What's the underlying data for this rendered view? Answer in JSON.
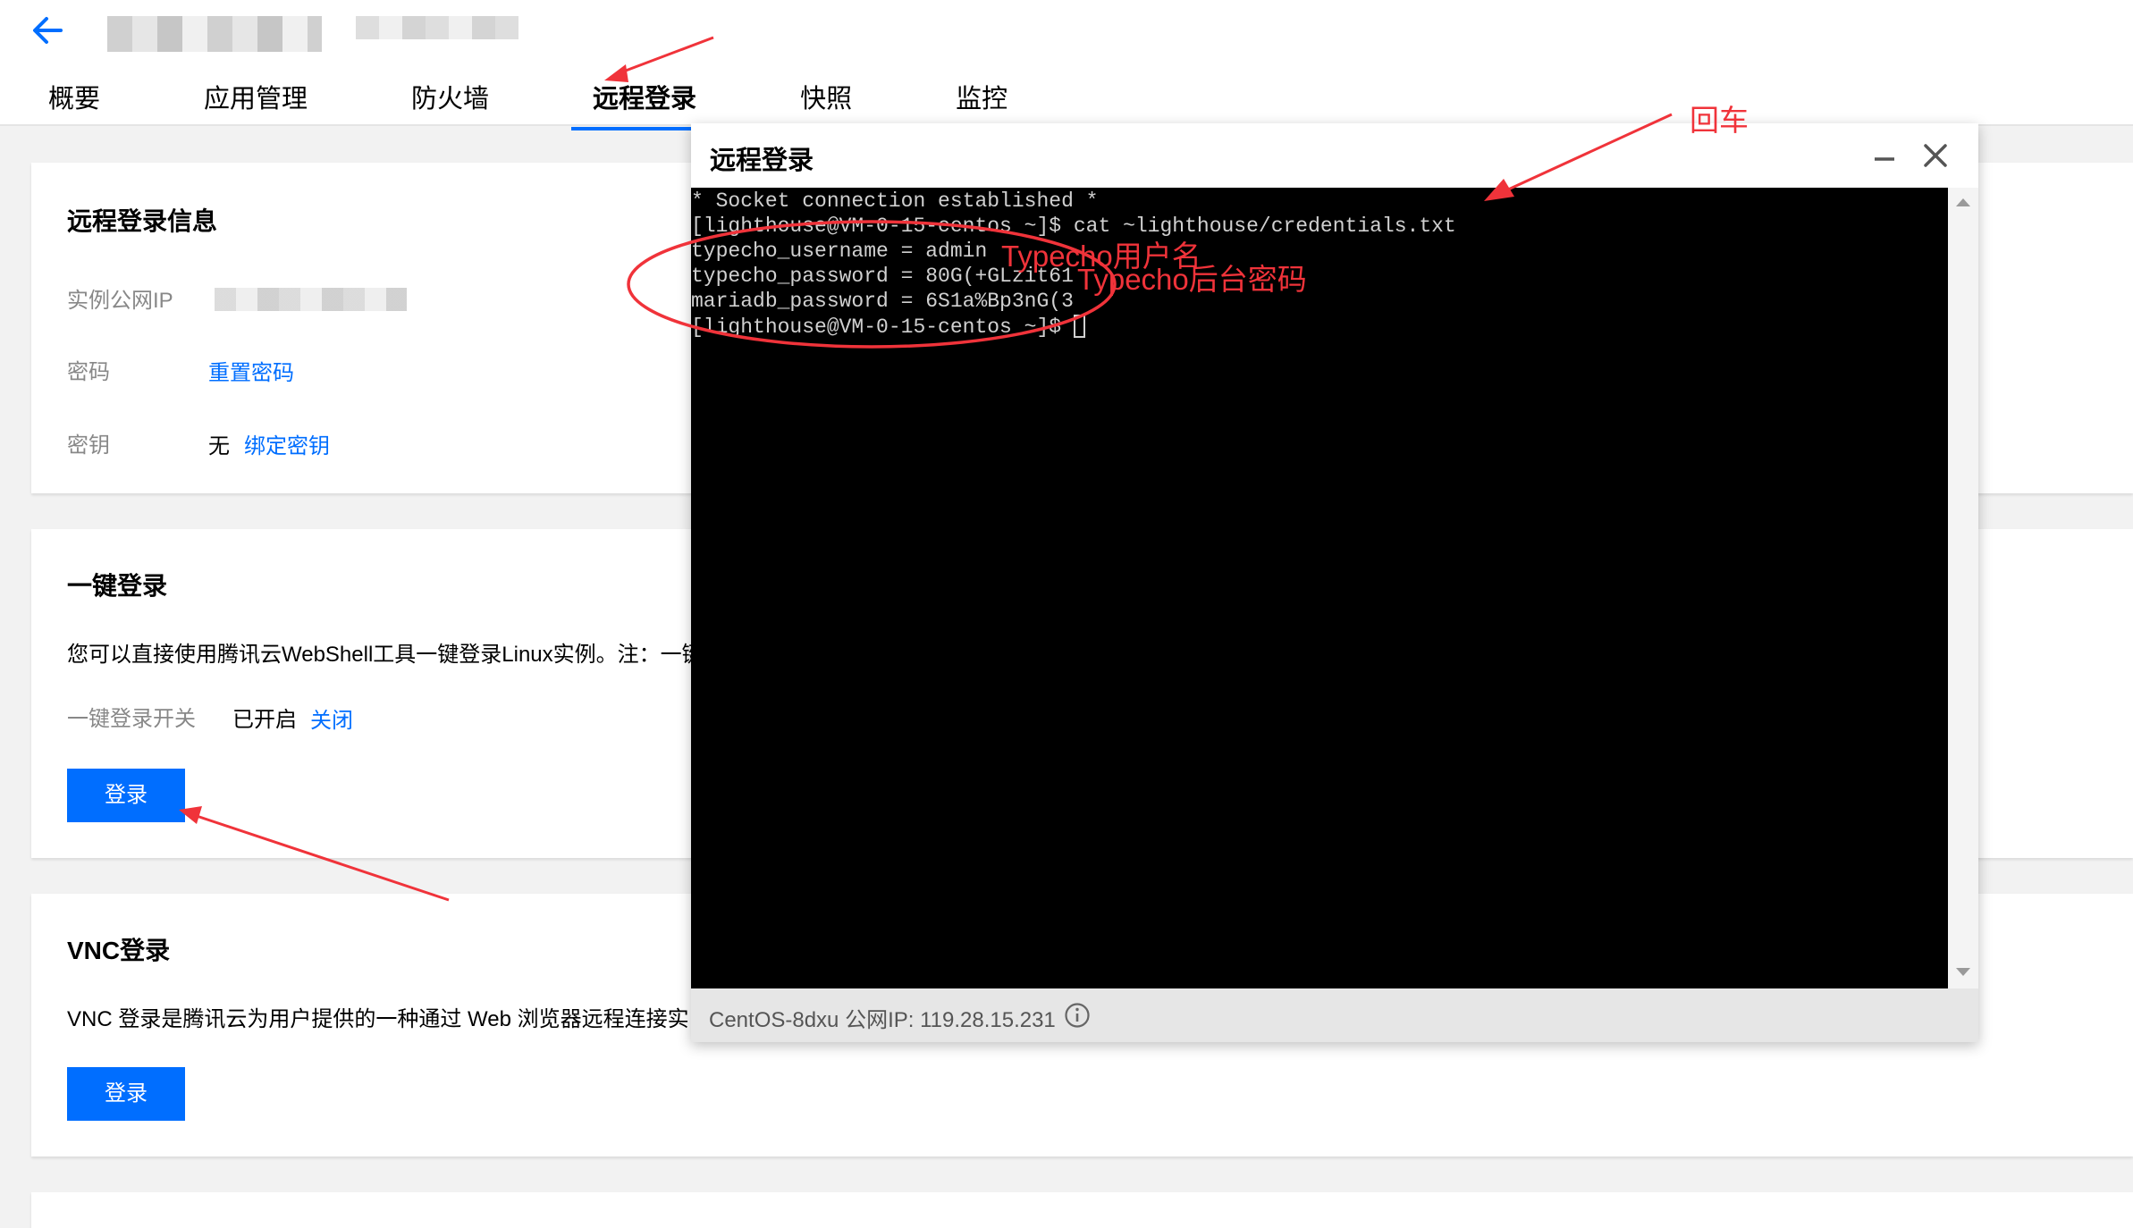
{
  "header": {
    "back_icon": "arrow-left-icon",
    "tabs": [
      {
        "label": "概要"
      },
      {
        "label": "应用管理"
      },
      {
        "label": "防火墙"
      },
      {
        "label": "远程登录",
        "active": true
      },
      {
        "label": "快照"
      },
      {
        "label": "监控"
      }
    ]
  },
  "remote_info": {
    "title": "远程登录信息",
    "ip_label": "实例公网IP",
    "password_label": "密码",
    "reset_password": "重置密码",
    "key_label": "密钥",
    "key_value": "无",
    "bind_key": "绑定密钥"
  },
  "one_click": {
    "title": "一键登录",
    "description": "您可以直接使用腾讯云WebShell工具一键登录Linux实例。注：一键",
    "switch_label": "一键登录开关",
    "switch_state": "已开启",
    "close_link": "关闭",
    "login_button": "登录"
  },
  "vnc": {
    "title": "VNC登录",
    "description": "VNC 登录是腾讯云为用户提供的一种通过 Web 浏览器远程连接实",
    "login_button": "登录"
  },
  "dialog": {
    "title": "远程登录",
    "minimize_icon": "minimize-icon",
    "close_icon": "close-icon",
    "terminal_lines": [
      "* Socket connection established *",
      "[lighthouse@VM-0-15-centos ~]$ cat ~lighthouse/credentials.txt",
      "typecho_username = admin",
      "typecho_password = 80G(+GLzit61",
      "mariadb_password = 6S1a%Bp3nG(3",
      "[lighthouse@VM-0-15-centos ~]$ "
    ],
    "status": "CentOS-8dxu 公网IP: 119.28.15.231",
    "info_icon": "info-icon"
  },
  "annotations": {
    "enter": "回车",
    "username": "Typecho用户名",
    "password": "Typecho后台密码"
  },
  "colors": {
    "primary": "#006eff",
    "annotation_red": "#f0333a",
    "terminal_bg": "#000000",
    "terminal_text": "#d0d0d0"
  }
}
